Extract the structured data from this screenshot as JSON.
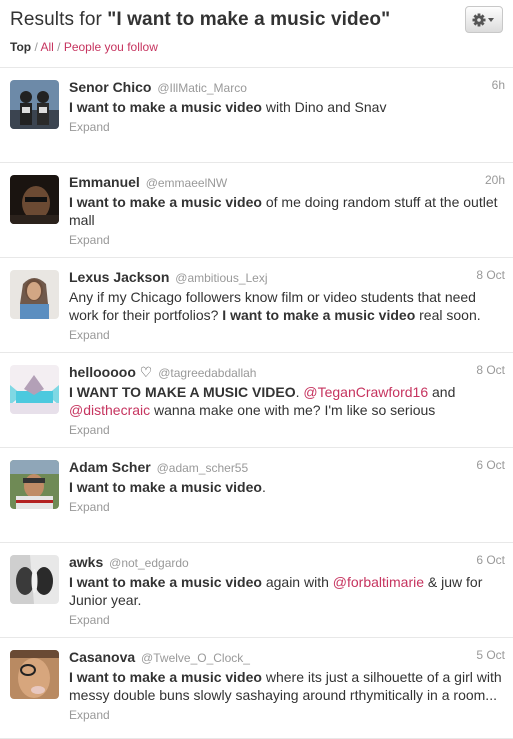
{
  "header": {
    "title_prefix": "Results for ",
    "query": "\"I want to make a music video\"",
    "filters": {
      "top": "Top",
      "sep1": " / ",
      "all": "All",
      "sep2": " / ",
      "follow": "People you follow"
    },
    "gear_icon": "gear-icon"
  },
  "accent_color": "#c6345f",
  "expand_label": "Expand",
  "tweets": [
    {
      "name": "Senor Chico",
      "handle": "@IllMatic_Marco",
      "time": "6h",
      "t0": "",
      "b0": "I want to make a music video",
      "t1": " with Dino and Snav"
    },
    {
      "name": "Emmanuel",
      "handle": "@emmaeelNW",
      "time": "20h",
      "t0": "",
      "b0": "I want to make a music video",
      "t1": " of me doing random stuff at the outlet mall"
    },
    {
      "name": "Lexus Jackson",
      "handle": "@ambitious_Lexj",
      "time": "8 Oct",
      "t0": "Any if my Chicago followers know film or video students that need work for their portfolios? ",
      "b0": "I want to make a music video",
      "t1": " real soon."
    },
    {
      "name": "hellooooo ♡",
      "handle": "@tagreedabdallah",
      "time": "8 Oct",
      "t0": "",
      "b0": "I WANT TO MAKE A MUSIC VIDEO",
      "t1": ". ",
      "m0": "@TeganCrawford16",
      "t2": " and ",
      "m1": "@disthecraic",
      "t3": " wanna make one with me? I'm like so serious"
    },
    {
      "name": "Adam Scher",
      "handle": "@adam_scher55",
      "time": "6 Oct",
      "t0": "",
      "b0": "I want to make a music video",
      "t1": "."
    },
    {
      "name": "awks",
      "handle": "@not_edgardo",
      "time": "6 Oct",
      "t0": "",
      "b0": "I want to make a music video",
      "t1": " again with ",
      "m0": "@forbaltimarie",
      "t2": " & juw for Junior year."
    },
    {
      "name": "Casanova",
      "handle": "@Twelve_O_Clock_",
      "time": "5 Oct",
      "t0": "",
      "b0": "I want to make a music video",
      "t1": " where its just a silhouette of a girl with messy double buns slowly sashaying around rthymitically in a room..."
    }
  ]
}
